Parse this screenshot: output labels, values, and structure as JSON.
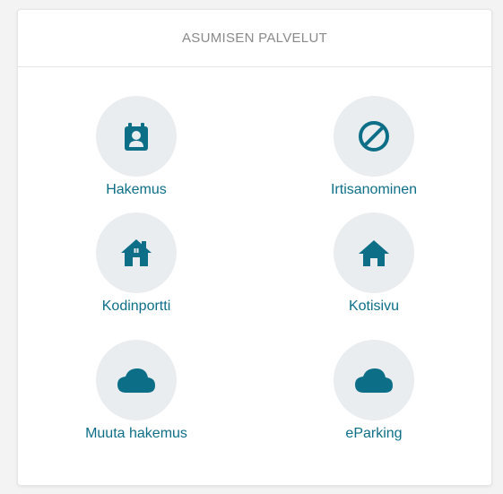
{
  "card": {
    "title": "ASUMISEN PALVELUT"
  },
  "colors": {
    "accent": "#0d6f87",
    "circle": "#e9edf0",
    "header_text": "#8a8a8a"
  },
  "tiles": [
    {
      "label": "Hakemus",
      "icon": "calendar-user-icon"
    },
    {
      "label": "Irtisanominen",
      "icon": "ban-icon"
    },
    {
      "label": "Kodinportti",
      "icon": "house-chimney-icon"
    },
    {
      "label": "Kotisivu",
      "icon": "home-icon"
    },
    {
      "label": "Muuta hakemus",
      "icon": "cloud-icon"
    },
    {
      "label": "eParking",
      "icon": "cloud-icon"
    }
  ]
}
